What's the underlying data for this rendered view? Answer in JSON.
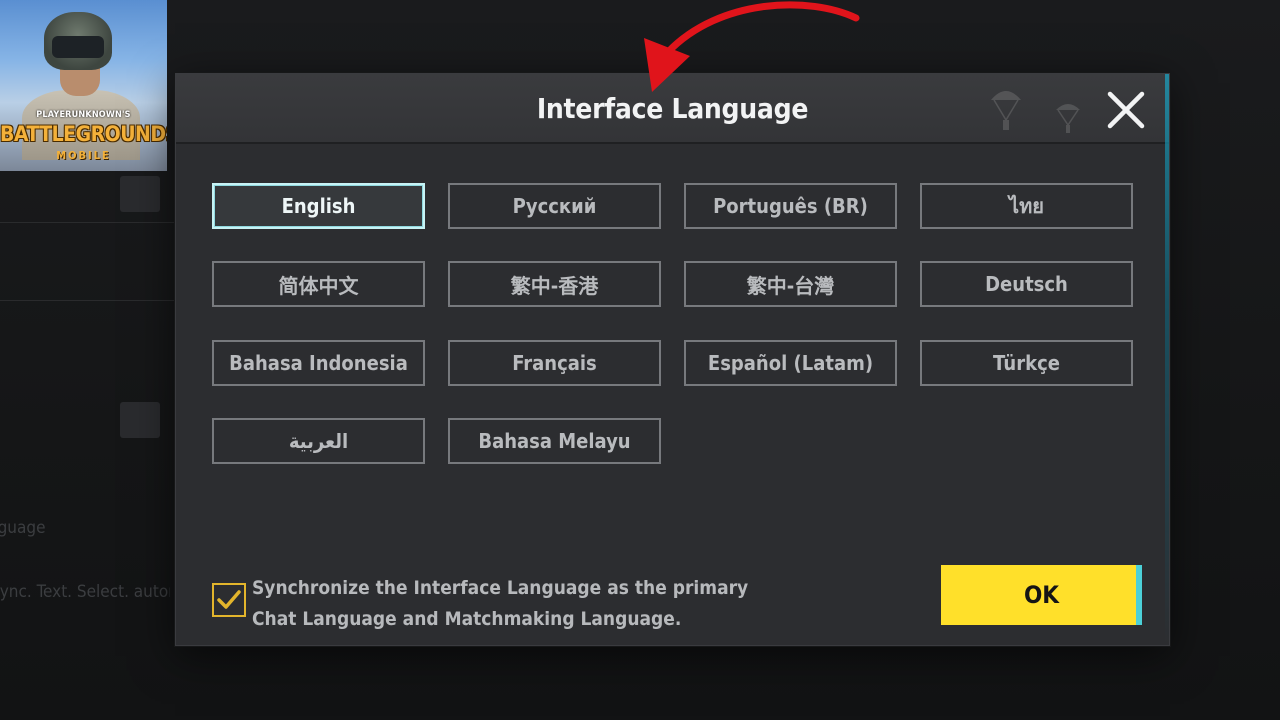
{
  "logo": {
    "small_text": "PLAYERUNKNOWN'S",
    "big_text": "BATTLEGROUNDS",
    "sub_text": "MOBILE"
  },
  "background": {
    "faded_labels": [
      "Language",
      "Sync. Text. Select. automatically"
    ]
  },
  "dialog": {
    "title": "Interface Language",
    "close_icon": "close-icon",
    "selected_language": "English",
    "languages": [
      {
        "label": "English"
      },
      {
        "label": "Русский"
      },
      {
        "label": "Português (BR)"
      },
      {
        "label": "ไทย"
      },
      {
        "label": "简体中文"
      },
      {
        "label": "繁中-香港"
      },
      {
        "label": "繁中-台灣"
      },
      {
        "label": "Deutsch"
      },
      {
        "label": "Bahasa Indonesia"
      },
      {
        "label": "Français"
      },
      {
        "label": "Español (Latam)"
      },
      {
        "label": "Türkçe"
      },
      {
        "label": "العربية"
      },
      {
        "label": "Bahasa Melayu"
      }
    ],
    "sync_checked": true,
    "sync_text_line1": "Synchronize the Interface Language as the primary",
    "sync_text_line2": "Chat Language and Matchmaking Language.",
    "ok_label": "OK"
  },
  "colors": {
    "accent_yellow": "#ffe02a",
    "checkbox_border": "#e3b52c",
    "selected_border": "#c7f3f5",
    "annotation_red": "#e0141b"
  }
}
